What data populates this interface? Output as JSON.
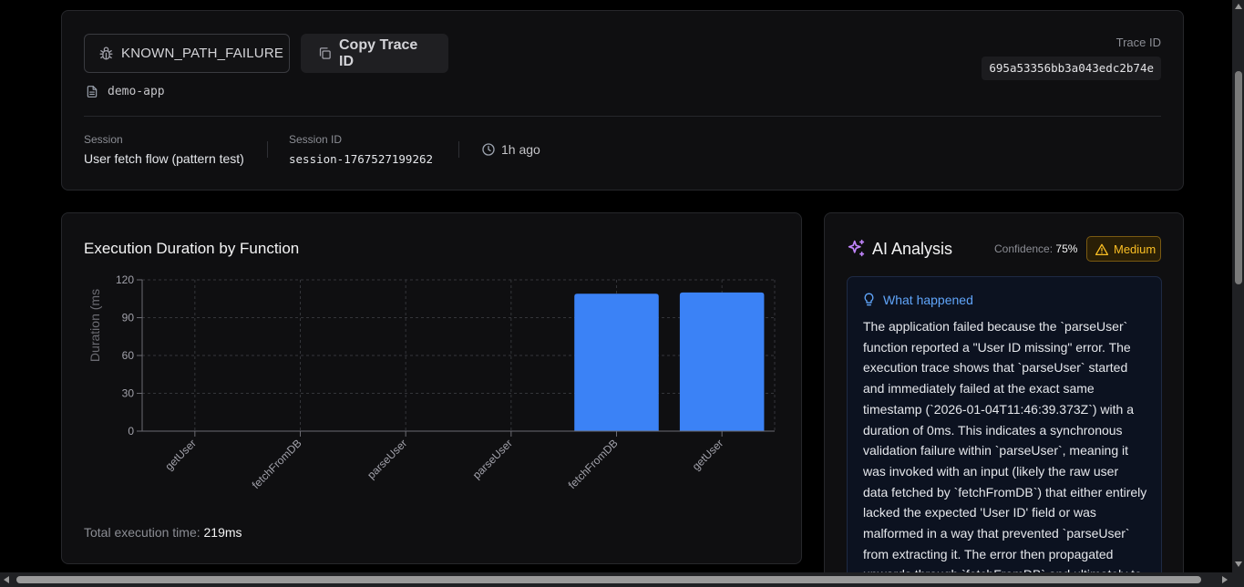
{
  "header": {
    "error_type": "KNOWN_PATH_FAILURE",
    "copy_label": "Copy Trace ID",
    "app_name": "demo-app",
    "trace_id_label": "Trace ID",
    "trace_id": "695a53356bb3a043edc2b74e",
    "session_label": "Session",
    "session_name": "User fetch flow (pattern test)",
    "session_id_label": "Session ID",
    "session_id": "session-1767527199262",
    "time_ago": "1h ago",
    "icons": [
      "bug-icon",
      "copy-icon",
      "file-icon",
      "clock-icon"
    ]
  },
  "chart_card": {
    "title": "Execution Duration by Function",
    "total_label": "Total execution time:",
    "total_value": "219ms"
  },
  "chart_data": {
    "type": "bar",
    "categories": [
      "getUser",
      "fetchFromDB",
      "parseUser",
      "parseUser",
      "fetchFromDB",
      "getUser"
    ],
    "values": [
      0,
      0,
      0,
      0,
      109,
      110
    ],
    "ylabel": "Duration (ms",
    "ylim": [
      0,
      120
    ],
    "yticks": [
      0,
      30,
      60,
      90,
      120
    ],
    "grid": true,
    "bar_color": "#3b82f6"
  },
  "ai": {
    "title": "AI Analysis",
    "confidence_label": "Confidence:",
    "confidence_value": "75%",
    "level": "Medium",
    "what_happened_label": "What happened",
    "lines": [
      "The application failed because the `parseUser`",
      "function reported a \"User ID missing\" error. The",
      "execution trace shows that `parseUser` started",
      "and immediately failed at the exact same",
      "timestamp (`2026-01-04T11:46:39.373Z`) with a",
      "duration of 0ms. This indicates a synchronous",
      "validation failure within `parseUser`, meaning it",
      "was invoked with an input (likely the raw user",
      "data fetched by `fetchFromDB`) that either entirely",
      "lacked the expected 'User ID' field or was",
      "malformed in a way that prevented `parseUser`",
      "from extracting it. The error then propagated",
      "upwards through `fetchFromDB` and ultimately to"
    ],
    "colors": {
      "accent": "#c084fc",
      "info": "#60a5fa",
      "warning": "#fbbf24"
    }
  }
}
